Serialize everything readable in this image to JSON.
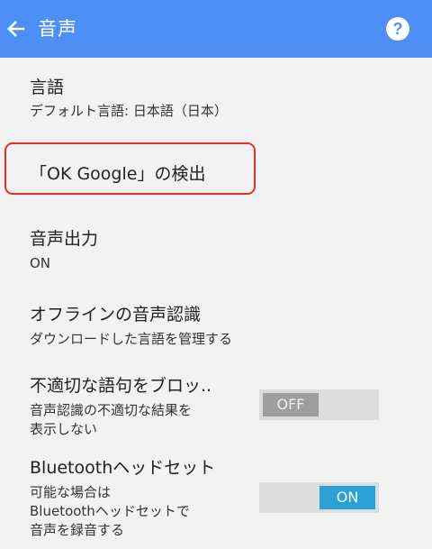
{
  "header": {
    "title": "音声",
    "back_icon": "arrow-left-icon",
    "help_icon": "help-circle-icon",
    "color": "#4d8ff5"
  },
  "items": [
    {
      "title": "言語",
      "subtitle": "デフォルト言語: 日本語（日本）"
    },
    {
      "title": "「OK Google」の検出"
    },
    {
      "title": "音声出力",
      "subtitle": "ON"
    },
    {
      "title": "オフラインの音声認識",
      "subtitle": "ダウンロードした言語を管理する"
    },
    {
      "title": "不適切な語句をブロッ..",
      "subtitle_lines": [
        "音声認識の不適切な結果を",
        "表示しない"
      ],
      "switch_label": "OFF",
      "switch_state": false
    },
    {
      "title": "Bluetoothヘッドセット",
      "subtitle_lines": [
        "可能な場合は",
        "Bluetoothヘッドセットで",
        "音声を録音する"
      ],
      "switch_label": "ON",
      "switch_state": true
    }
  ],
  "colors": {
    "highlight_border": "#e0312f",
    "switch_on": "#2aa0d6",
    "switch_off": "#9e9e9e"
  }
}
